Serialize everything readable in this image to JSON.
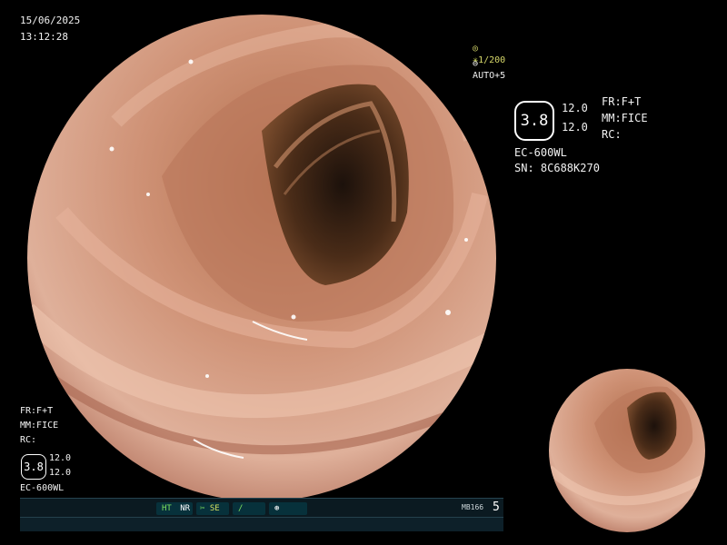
{
  "datetime": {
    "date": "15/06/2025",
    "time": "13:12:28"
  },
  "shutter": {
    "icon": "aperture-icon",
    "star": "✳",
    "value": "1/200"
  },
  "auto": {
    "icon": "auto-exposure-icon",
    "label": "AUTO+5"
  },
  "right_panel": {
    "octagon_value": "3.8",
    "val_a": "12.0",
    "val_b": "12.0",
    "fr": "FR:F+T",
    "mm": "MM:FICE",
    "rc": "RC:",
    "model": "EC-600WL",
    "serial": "SN: 8C688K270"
  },
  "left_panel": {
    "fr": "FR:F+T",
    "mm": "MM:FICE",
    "rc": "RC:",
    "octagon_value": "3.8",
    "val_a": "12.0",
    "val_b": "12.0",
    "model": "EC-600WL"
  },
  "status_bar": {
    "ht": "HT",
    "nr": "NR",
    "se": "SE",
    "code": "MB166",
    "count": "5"
  },
  "colors": {
    "tissue": "#c48068",
    "tissue_light": "#e7b7a0",
    "lumen": "#2b1a0f",
    "bar": "#0d2029"
  }
}
